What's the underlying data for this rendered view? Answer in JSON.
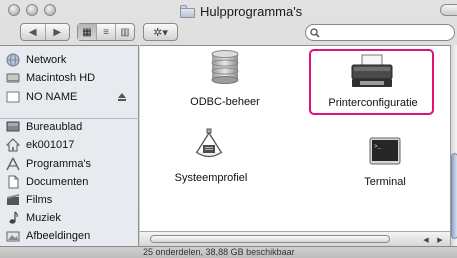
{
  "window": {
    "title": "Hulpprogramma's"
  },
  "toolbar": {
    "back_glyph": "◀",
    "forward_glyph": "▶",
    "view_icon_glyph": "▦",
    "view_list_glyph": "≡",
    "view_column_glyph": "▥",
    "action_glyph": "✲▾",
    "search": {
      "value": "",
      "placeholder": ""
    }
  },
  "sidebar": {
    "devices": [
      {
        "label": "Network",
        "icon": "network-icon"
      },
      {
        "label": "Macintosh HD",
        "icon": "hard-disk-icon"
      },
      {
        "label": "NO NAME",
        "icon": "volume-icon"
      }
    ],
    "places": [
      {
        "label": "Bureaublad",
        "icon": "desktop-icon"
      },
      {
        "label": "ek001017",
        "icon": "home-icon"
      },
      {
        "label": "Programma's",
        "icon": "applications-icon"
      },
      {
        "label": "Documenten",
        "icon": "documents-icon"
      },
      {
        "label": "Films",
        "icon": "movies-icon"
      },
      {
        "label": "Muziek",
        "icon": "music-icon"
      },
      {
        "label": "Afbeeldingen",
        "icon": "pictures-icon"
      }
    ]
  },
  "items": [
    {
      "label": "ODBC-beheer",
      "icon": "odbc-icon",
      "selected": false
    },
    {
      "label": "Printerconfiguratie",
      "icon": "printer-icon",
      "selected": true
    },
    {
      "label": "Systeemprofiel",
      "icon": "system-profiler-icon",
      "selected": false
    },
    {
      "label": "Terminal",
      "icon": "terminal-icon",
      "selected": false
    }
  ],
  "statusbar": {
    "text": "25 onderdelen, 38,88 GB beschikbaar"
  },
  "colors": {
    "selection_highlight": "#e0107a",
    "sidebar_bg": "#e7ebf0"
  }
}
